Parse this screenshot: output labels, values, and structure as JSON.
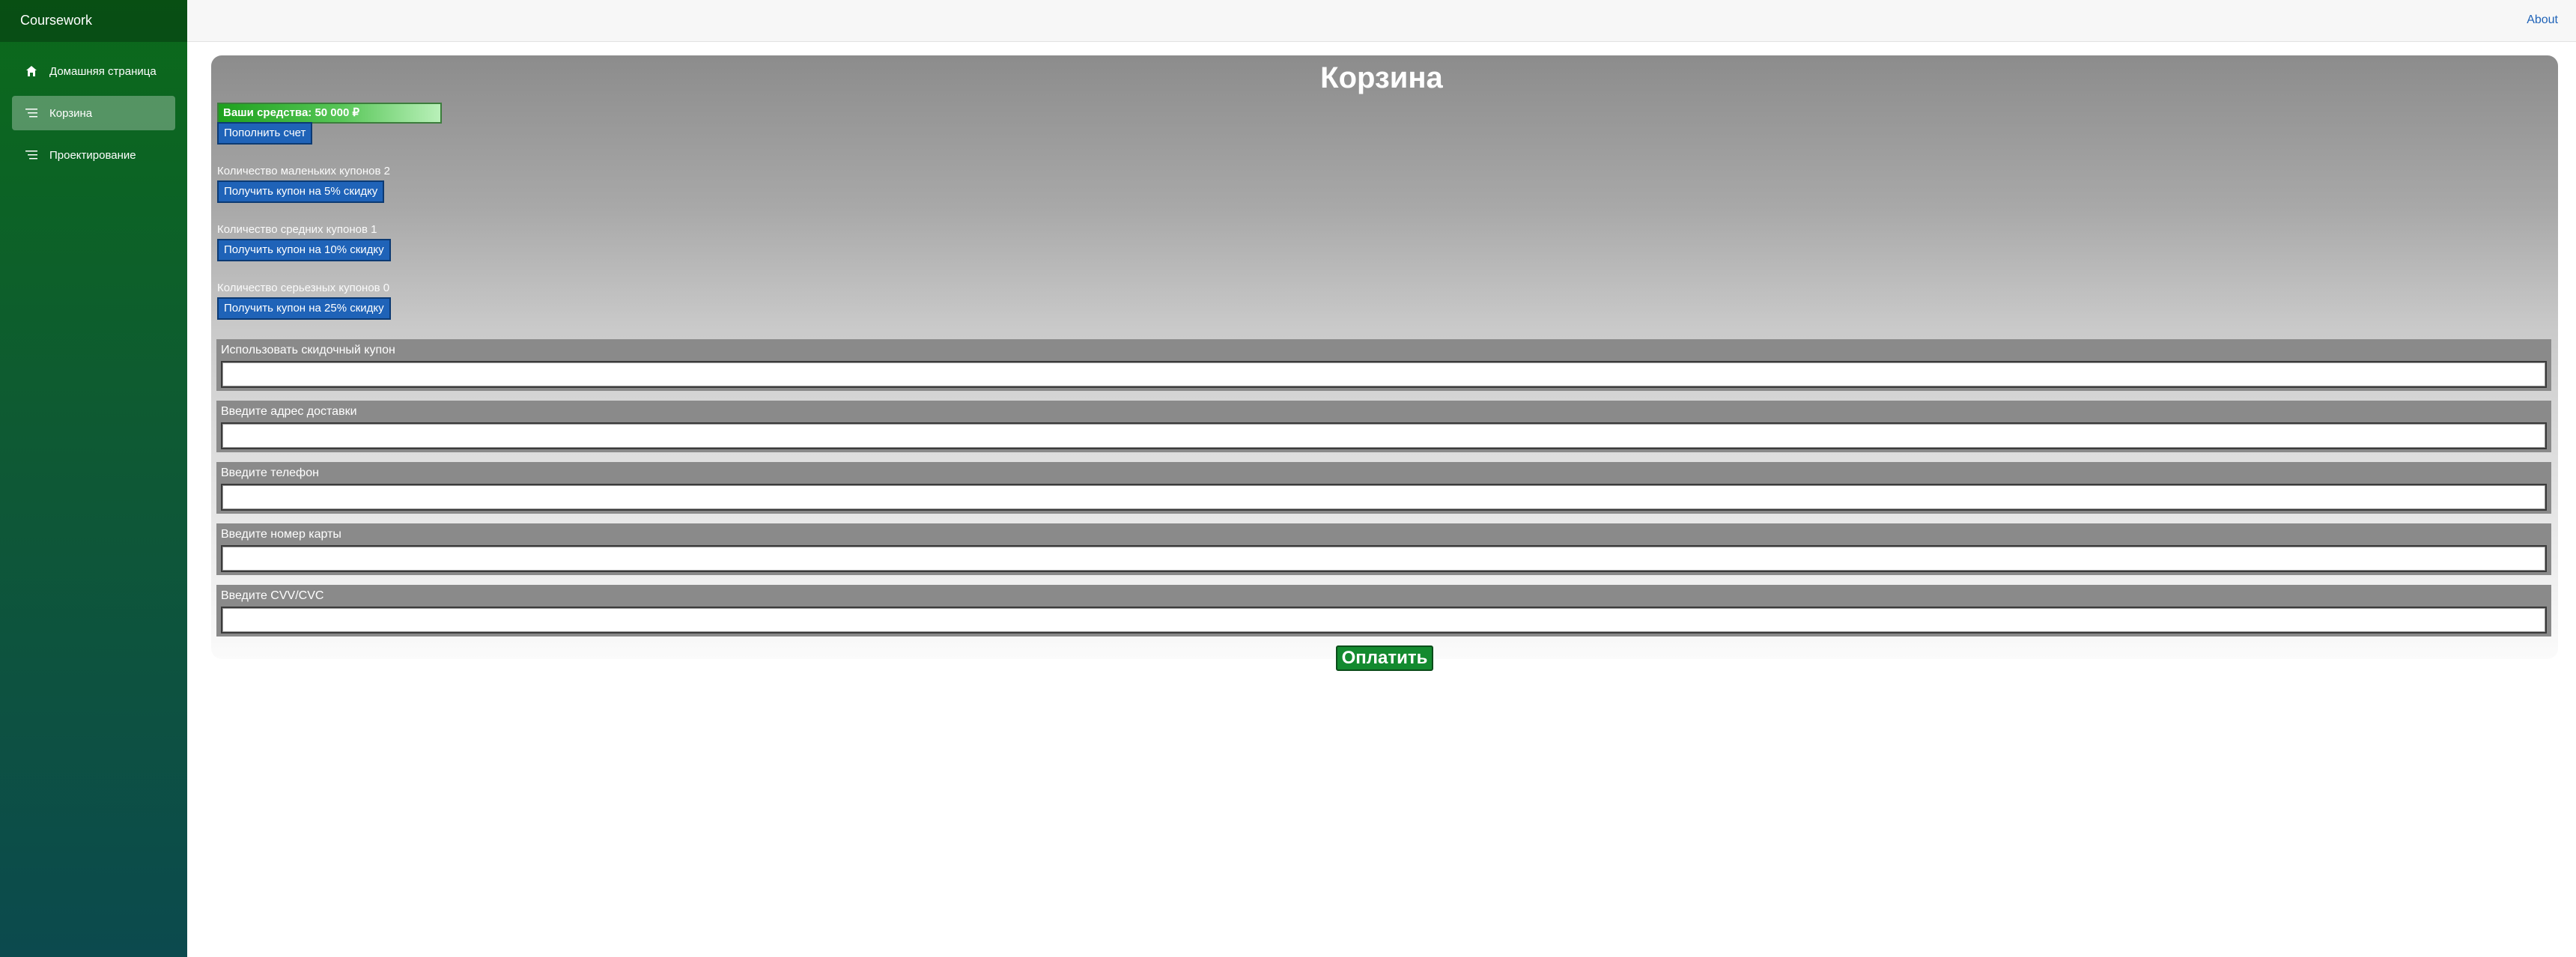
{
  "brand": "Coursework",
  "nav": {
    "items": [
      {
        "label": "Домашняя страница",
        "icon": "home-icon"
      },
      {
        "label": "Корзина",
        "icon": "list-icon",
        "active": true
      },
      {
        "label": "Проектирование",
        "icon": "list-icon"
      }
    ]
  },
  "topbar": {
    "about": "About"
  },
  "cart": {
    "title": "Корзина",
    "funds": "Ваши средства: 50 000 ₽",
    "topup": "Пополнить счет",
    "small_count": "Количество маленьких купонов 2",
    "small_btn": "Получить купон на 5% скидку",
    "medium_count": "Количество средних купонов 1",
    "medium_btn": "Получить купон на 10% скидку",
    "big_count": "Количество серьезных купонов 0",
    "big_btn": "Получить купон на 25% скидку",
    "fields": {
      "coupon": {
        "label": "Использовать скидочный купон",
        "value": ""
      },
      "address": {
        "label": "Введите адрес доставки",
        "value": ""
      },
      "phone": {
        "label": "Введите телефон",
        "value": ""
      },
      "card": {
        "label": "Введите номер карты",
        "value": ""
      },
      "cvv": {
        "label": "Введите CVV/CVC",
        "value": ""
      }
    },
    "pay": "Оплатить"
  },
  "colors": {
    "sidebar": "#0b6a1a",
    "accent": "#1f63b8",
    "pay": "#138a2f"
  }
}
